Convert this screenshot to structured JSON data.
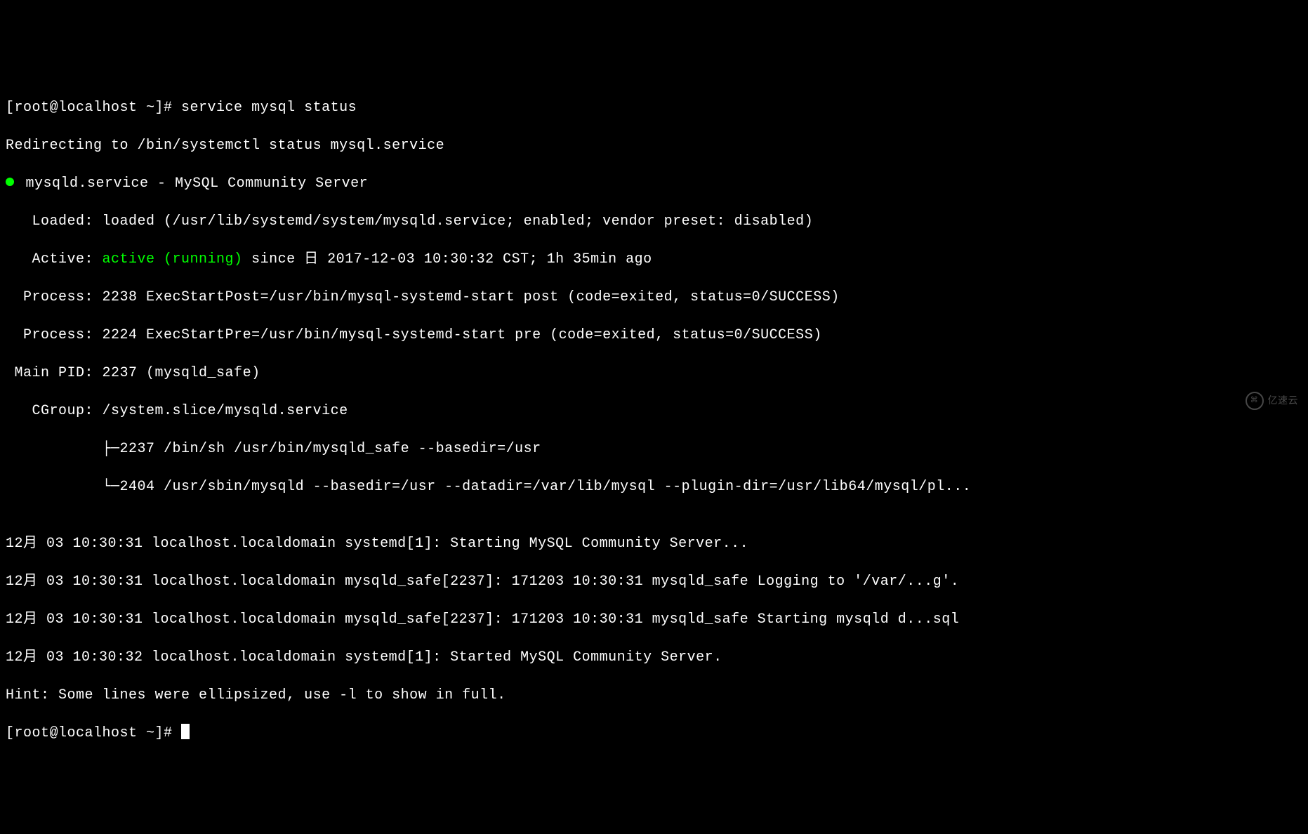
{
  "prompt1": {
    "user_host": "[root@localhost ~]# ",
    "command": "service mysql status"
  },
  "redirect": "Redirecting to /bin/systemctl status mysql.service",
  "service_line": {
    "name": "mysqld.service",
    "sep": " - ",
    "desc": "MySQL Community Server"
  },
  "loaded": {
    "label": "   Loaded: ",
    "value": "loaded (/usr/lib/systemd/system/mysqld.service; enabled; vendor preset: disabled)"
  },
  "active": {
    "label": "   Active: ",
    "state": "active (running)",
    "since": " since 日 2017-12-03 10:30:32 CST; 1h 35min ago"
  },
  "process1": {
    "label": "  Process: ",
    "value": "2238 ExecStartPost=/usr/bin/mysql-systemd-start post (code=exited, status=0/SUCCESS)"
  },
  "process2": {
    "label": "  Process: ",
    "value": "2224 ExecStartPre=/usr/bin/mysql-systemd-start pre (code=exited, status=0/SUCCESS)"
  },
  "mainpid": {
    "label": " Main PID: ",
    "value": "2237 (mysqld_safe)"
  },
  "cgroup": {
    "label": "   CGroup: ",
    "value": "/system.slice/mysqld.service"
  },
  "cgroup_child1": "           ├─2237 /bin/sh /usr/bin/mysqld_safe --basedir=/usr",
  "cgroup_child2": "           └─2404 /usr/sbin/mysqld --basedir=/usr --datadir=/var/lib/mysql --plugin-dir=/usr/lib64/mysql/pl...",
  "blank": "",
  "log1": "12月 03 10:30:31 localhost.localdomain systemd[1]: Starting MySQL Community Server...",
  "log2": "12月 03 10:30:31 localhost.localdomain mysqld_safe[2237]: 171203 10:30:31 mysqld_safe Logging to '/var/...g'.",
  "log3": "12月 03 10:30:31 localhost.localdomain mysqld_safe[2237]: 171203 10:30:31 mysqld_safe Starting mysqld d...sql",
  "log4": "12月 03 10:30:32 localhost.localdomain systemd[1]: Started MySQL Community Server.",
  "hint": "Hint: Some lines were ellipsized, use -l to show in full.",
  "prompt2": {
    "user_host": "[root@localhost ~]# "
  },
  "watermark": "亿速云"
}
